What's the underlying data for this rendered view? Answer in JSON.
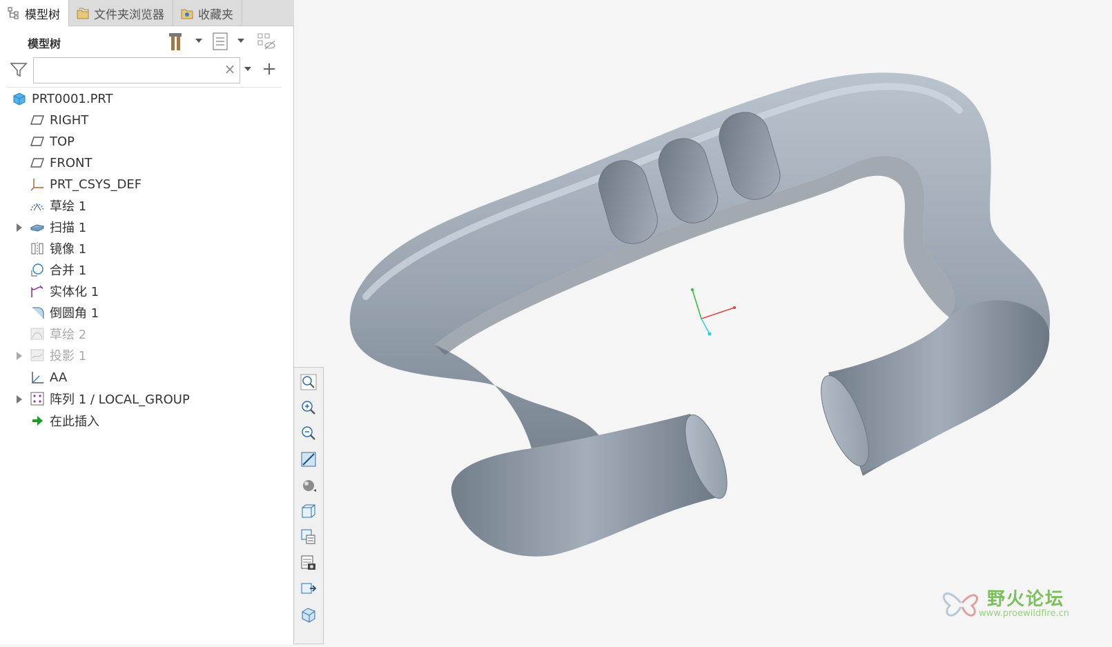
{
  "tabs": [
    {
      "label": "模型树",
      "icon": "model-tree-icon",
      "active": true
    },
    {
      "label": "文件夹浏览器",
      "icon": "folder-browser-icon",
      "active": false
    },
    {
      "label": "收藏夹",
      "icon": "favorites-icon",
      "active": false
    }
  ],
  "panel": {
    "title": "模型树",
    "tools": [
      "settings-tools-icon",
      "tree-columns-icon",
      "show-hide-icon"
    ]
  },
  "filter": {
    "icon": "filter-icon",
    "value": "",
    "placeholder": "",
    "clear": "×",
    "add": "+"
  },
  "tree": {
    "root": "PRT0001.PRT",
    "items": [
      {
        "label": "RIGHT",
        "icon": "datum-plane-icon",
        "dim": false,
        "expandable": false
      },
      {
        "label": "TOP",
        "icon": "datum-plane-icon",
        "dim": false,
        "expandable": false
      },
      {
        "label": "FRONT",
        "icon": "datum-plane-icon",
        "dim": false,
        "expandable": false
      },
      {
        "label": "PRT_CSYS_DEF",
        "icon": "csys-icon",
        "dim": false,
        "expandable": false
      },
      {
        "label": "草绘 1",
        "icon": "sketch-icon",
        "dim": false,
        "expandable": false
      },
      {
        "label": "扫描 1",
        "icon": "sweep-icon",
        "dim": false,
        "expandable": true
      },
      {
        "label": "镜像 1",
        "icon": "mirror-icon",
        "dim": false,
        "expandable": false
      },
      {
        "label": "合并 1",
        "icon": "merge-icon",
        "dim": false,
        "expandable": false
      },
      {
        "label": "实体化 1",
        "icon": "solidify-icon",
        "dim": false,
        "expandable": false
      },
      {
        "label": "倒圆角 1",
        "icon": "round-icon",
        "dim": false,
        "expandable": false
      },
      {
        "label": "草绘 2",
        "icon": "sketch-icon",
        "dim": true,
        "expandable": false
      },
      {
        "label": "投影 1",
        "icon": "project-icon",
        "dim": true,
        "expandable": true
      },
      {
        "label": "AA",
        "icon": "csys-icon",
        "dim": false,
        "expandable": false
      },
      {
        "label": "阵列 1 / LOCAL_GROUP",
        "icon": "pattern-icon",
        "dim": false,
        "expandable": true
      },
      {
        "label": "在此插入",
        "icon": "insert-here-icon",
        "dim": false,
        "expandable": false
      }
    ]
  },
  "view_toolbar": [
    "refit-icon",
    "zoom-in-icon",
    "zoom-out-icon",
    "repaint-icon",
    "display-style-icon",
    "saved-orientations-icon",
    "view-manager-icon",
    "snapshot-icon",
    "annotation-display-icon",
    "spin-center-icon"
  ],
  "watermark": {
    "title": "野火论坛",
    "url": "www.proewildfire.cn"
  },
  "colors": {
    "model": "#9ba6b2",
    "model_shadow": "#6e7884",
    "accent": "#2a7fc0"
  }
}
